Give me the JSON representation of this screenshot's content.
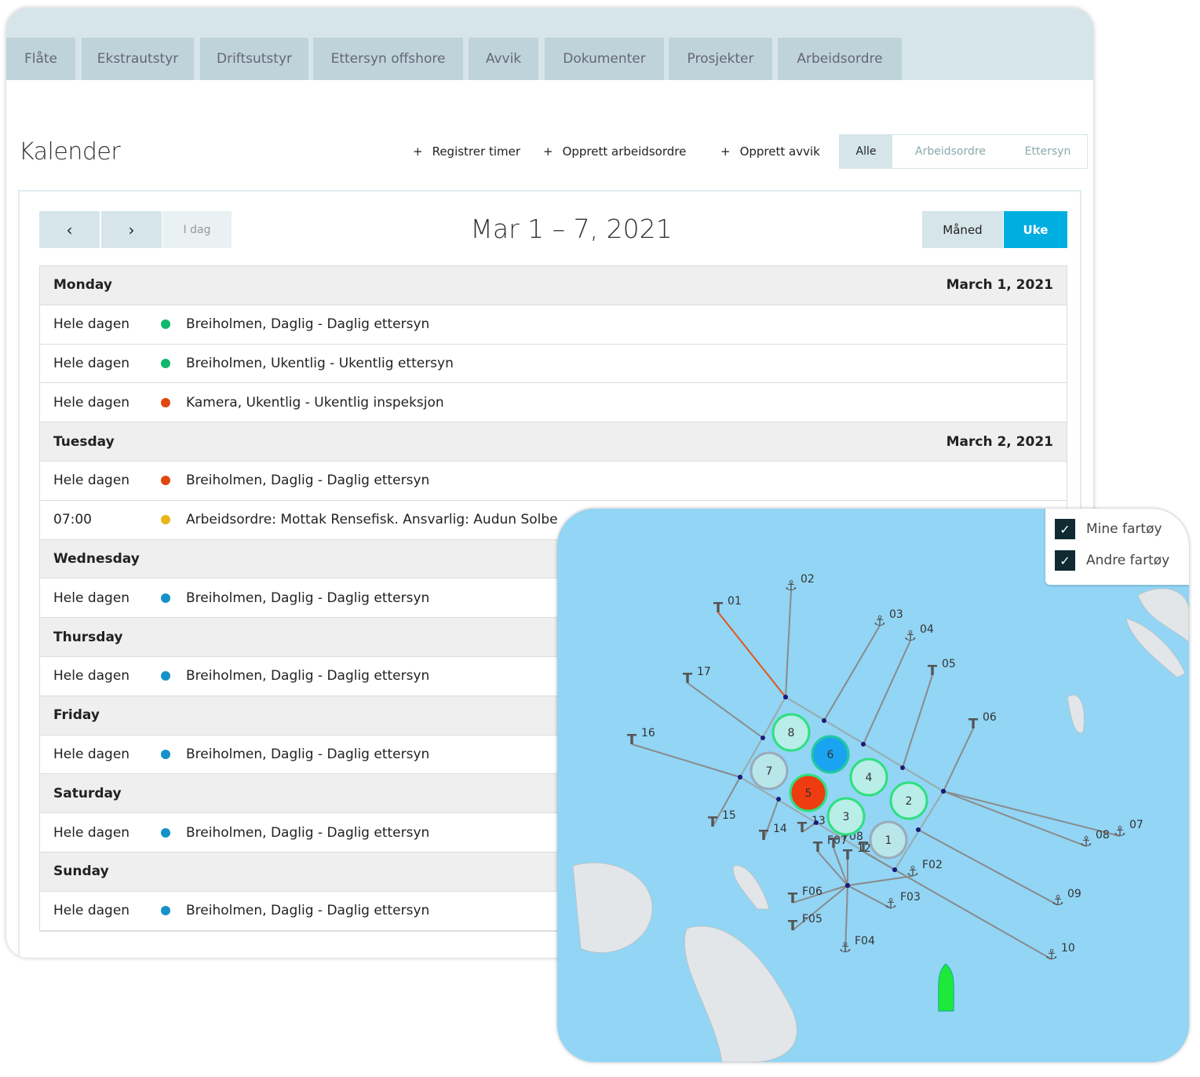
{
  "tabs": [
    "Flåte",
    "Ekstrautstyr",
    "Driftsutstyr",
    "Ettersyn offshore",
    "Avvik",
    "Dokumenter",
    "Prosjekter",
    "Arbeidsordre"
  ],
  "page_title": "Kalender",
  "actions": [
    "Registrer timer",
    "Opprett arbeidsordre",
    "Opprett avvik"
  ],
  "filters": {
    "options": [
      "Alle",
      "Arbeidsordre",
      "Ettersyn"
    ],
    "selected": "Alle"
  },
  "nav": {
    "prev": "‹",
    "next": "›",
    "today": "I dag"
  },
  "range": "Mar 1 – 7, 2021",
  "views": {
    "options": [
      "Måned",
      "Uke"
    ],
    "selected": "Uke"
  },
  "colors": {
    "accent": "#00aee0",
    "green": "#11b76b",
    "orange": "#e0470f",
    "yellow": "#e8b61a",
    "blue": "#1591c9"
  },
  "days": [
    {
      "name": "Monday",
      "date": "March 1, 2021",
      "events": [
        {
          "time": "Hele dagen",
          "color": "green",
          "text": "Breiholmen, Daglig - Daglig ettersyn"
        },
        {
          "time": "Hele dagen",
          "color": "green",
          "text": "Breiholmen, Ukentlig - Ukentlig ettersyn"
        },
        {
          "time": "Hele dagen",
          "color": "orange",
          "text": "Kamera, Ukentlig - Ukentlig inspeksjon"
        }
      ]
    },
    {
      "name": "Tuesday",
      "date": "March 2, 2021",
      "events": [
        {
          "time": "Hele dagen",
          "color": "orange",
          "text": "Breiholmen, Daglig - Daglig ettersyn"
        },
        {
          "time": "07:00",
          "color": "yellow",
          "text": "Arbeidsordre: Mottak Rensefisk. Ansvarlig: Audun Solbe"
        }
      ]
    },
    {
      "name": "Wednesday",
      "date": "",
      "events": [
        {
          "time": "Hele dagen",
          "color": "blue",
          "text": "Breiholmen, Daglig - Daglig ettersyn"
        }
      ]
    },
    {
      "name": "Thursday",
      "date": "",
      "events": [
        {
          "time": "Hele dagen",
          "color": "blue",
          "text": "Breiholmen, Daglig - Daglig ettersyn"
        }
      ]
    },
    {
      "name": "Friday",
      "date": "",
      "events": [
        {
          "time": "Hele dagen",
          "color": "blue",
          "text": "Breiholmen, Daglig - Daglig ettersyn"
        }
      ]
    },
    {
      "name": "Saturday",
      "date": "",
      "events": [
        {
          "time": "Hele dagen",
          "color": "blue",
          "text": "Breiholmen, Daglig - Daglig ettersyn"
        }
      ]
    },
    {
      "name": "Sunday",
      "date": "",
      "events": [
        {
          "time": "Hele dagen",
          "color": "blue",
          "text": "Breiholmen, Daglig - Daglig ettersyn"
        }
      ]
    }
  ],
  "map": {
    "legend": [
      {
        "label": "Mine fartøy",
        "checked": true
      },
      {
        "label": "Andre fartøy",
        "checked": true
      }
    ],
    "cages": [
      {
        "id": "8",
        "status": "normal"
      },
      {
        "id": "6",
        "status": "selected"
      },
      {
        "id": "7",
        "status": "inactive"
      },
      {
        "id": "4",
        "status": "normal"
      },
      {
        "id": "5",
        "status": "alert"
      },
      {
        "id": "2",
        "status": "normal"
      },
      {
        "id": "3",
        "status": "normal"
      },
      {
        "id": "1",
        "status": "inactive"
      }
    ],
    "anchors": [
      "01",
      "02",
      "03",
      "04",
      "05",
      "06",
      "07",
      "08",
      "09",
      "10",
      "16",
      "17",
      "15",
      "14",
      "13",
      "F02",
      "F03",
      "F05",
      "F06",
      "F04",
      "F07",
      "F08",
      "F01",
      "12"
    ]
  }
}
